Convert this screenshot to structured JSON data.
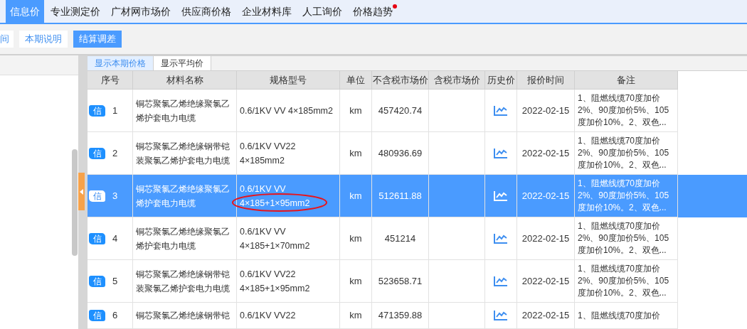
{
  "nav_tabs": [
    {
      "label": "信息价",
      "selected": true,
      "dot": false
    },
    {
      "label": "专业测定价",
      "selected": false,
      "dot": false
    },
    {
      "label": "广材网市场价",
      "selected": false,
      "dot": false
    },
    {
      "label": "供应商价格",
      "selected": false,
      "dot": false
    },
    {
      "label": "企业材料库",
      "selected": false,
      "dot": false
    },
    {
      "label": "人工询价",
      "selected": false,
      "dot": false
    },
    {
      "label": "价格趋势",
      "selected": false,
      "dot": true
    }
  ],
  "toolbar": [
    {
      "label": "间",
      "selected": false
    },
    {
      "label": "本期说明",
      "selected": false
    },
    {
      "label": "结算调差",
      "selected": true
    }
  ],
  "view_tabs": [
    {
      "label": "显示本期价格",
      "selected": true
    },
    {
      "label": "显示平均价",
      "selected": false
    }
  ],
  "table": {
    "columns": [
      "序号",
      "材料名称",
      "规格型号",
      "单位",
      "不含税市场价",
      "含税市场价",
      "历史价",
      "报价时间",
      "备注"
    ],
    "rows": [
      {
        "badge": "信",
        "index": "1",
        "name": [
          "铜芯聚氯乙烯绝缘聚氯乙",
          "烯护套电力电缆"
        ],
        "spec": [
          "0.6/1KV VV 4×185mm2"
        ],
        "unit": "km",
        "price": "457420.74",
        "date": "2022-02-15",
        "remark": [
          "1、阻燃线缆70度加价",
          "2%、90度加价5%、105",
          "度加价10%。2、双色..."
        ],
        "selected": false,
        "circled": false
      },
      {
        "badge": "信",
        "index": "2",
        "name": [
          "铜芯聚氯乙烯绝缘钢带铠",
          "装聚氯乙烯护套电力电缆"
        ],
        "spec": [
          "0.6/1KV VV22",
          "4×185mm2"
        ],
        "unit": "km",
        "price": "480936.69",
        "date": "2022-02-15",
        "remark": [
          "1、阻燃线缆70度加价",
          "2%、90度加价5%、105",
          "度加价10%。2、双色..."
        ],
        "selected": false,
        "circled": false
      },
      {
        "badge": "信",
        "index": "3",
        "name": [
          "铜芯聚氯乙烯绝缘聚氯乙",
          "烯护套电力电缆"
        ],
        "spec": [
          "0.6/1KV VV",
          "4×185+1×95mm2"
        ],
        "unit": "km",
        "price": "512611.88",
        "date": "2022-02-15",
        "remark": [
          "1、阻燃线缆70度加价",
          "2%、90度加价5%、105",
          "度加价10%。2、双色..."
        ],
        "selected": true,
        "circled": true
      },
      {
        "badge": "信",
        "index": "4",
        "name": [
          "铜芯聚氯乙烯绝缘聚氯乙",
          "烯护套电力电缆"
        ],
        "spec": [
          "0.6/1KV VV",
          "4×185+1×70mm2"
        ],
        "unit": "km",
        "price": "451214",
        "date": "2022-02-15",
        "remark": [
          "1、阻燃线缆70度加价",
          "2%、90度加价5%、105",
          "度加价10%。2、双色..."
        ],
        "selected": false,
        "circled": false
      },
      {
        "badge": "信",
        "index": "5",
        "name": [
          "铜芯聚氯乙烯绝缘钢带铠",
          "装聚氯乙烯护套电力电缆"
        ],
        "spec": [
          "0.6/1KV VV22",
          "4×185+1×95mm2"
        ],
        "unit": "km",
        "price": "523658.71",
        "date": "2022-02-15",
        "remark": [
          "1、阻燃线缆70度加价",
          "2%、90度加价5%、105",
          "度加价10%。2、双色..."
        ],
        "selected": false,
        "circled": false
      },
      {
        "badge": "信",
        "index": "6",
        "name": [
          "铜芯聚氯乙烯绝缘钢带铠"
        ],
        "spec": [
          "0.6/1KV VV22"
        ],
        "unit": "km",
        "price": "471359.88",
        "date": "2022-02-15",
        "remark": [
          "1、阻燃线缆70度加价"
        ],
        "selected": false,
        "circled": false
      }
    ]
  }
}
